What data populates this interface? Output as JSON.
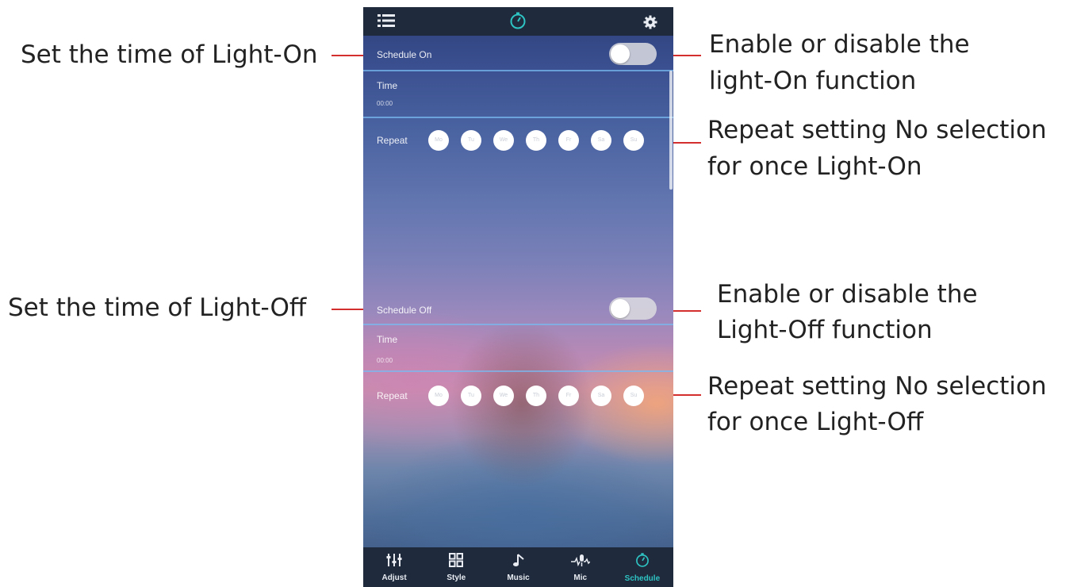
{
  "annotations": {
    "schedule_on_time": "Set the time of Light-On",
    "schedule_on_toggle_line1": "Enable or disable the",
    "schedule_on_toggle_line2": "light-On function",
    "repeat_on_line1": "Repeat setting No selection",
    "repeat_on_line2": "for once Light-On",
    "schedule_off_time": "Set the time of Light-Off",
    "schedule_off_toggle_line1": "Enable or disable the",
    "schedule_off_toggle_line2": "Light-Off function",
    "repeat_off_line1": "Repeat setting No selection",
    "repeat_off_line2": "for once Light-Off"
  },
  "topbar": {
    "left_icon": "list-icon",
    "center_icon": "timer-icon",
    "right_icon": "gear-icon"
  },
  "schedule_on": {
    "label": "Schedule On",
    "enabled": false,
    "time_label": "Time",
    "time_value": "00:00",
    "repeat_label": "Repeat",
    "days": [
      "Mo",
      "Tu",
      "We",
      "Th",
      "Fr",
      "Sa",
      "Su"
    ]
  },
  "schedule_off": {
    "label": "Schedule Off",
    "enabled": false,
    "time_label": "Time",
    "time_value": "00:00",
    "repeat_label": "Repeat",
    "days": [
      "Mo",
      "Tu",
      "We",
      "Th",
      "Fr",
      "Sa",
      "Su"
    ]
  },
  "bottom_nav": {
    "items": [
      {
        "label": "Adjust",
        "icon": "sliders-icon",
        "active": false
      },
      {
        "label": "Style",
        "icon": "grid-icon",
        "active": false
      },
      {
        "label": "Music",
        "icon": "music-note-icon",
        "active": false
      },
      {
        "label": "Mic",
        "icon": "microphone-icon",
        "active": false
      },
      {
        "label": "Schedule",
        "icon": "timer-icon",
        "active": true
      }
    ]
  },
  "colors": {
    "accent": "#2ec4c4",
    "callout_line": "#d32f2f",
    "bar_background": "#1f2a3c",
    "divider": "#78b9f0"
  }
}
